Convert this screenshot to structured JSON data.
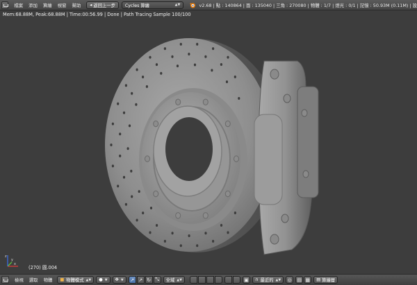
{
  "header": {
    "menus": [
      "檔案",
      "添加",
      "算繪",
      "視窗",
      "幫助"
    ],
    "back_button": "返回上一步",
    "render_engine": "Cycles 算繪",
    "stats": "v2.68 | 點 : 140864 | 面 : 135040 | 三角 : 270080 | 物體 : 1/7 | 燈光 : 0/1 | 記憶 : 50.93M (0.11M) | 設"
  },
  "viewport": {
    "render_status": "Mem:68.88M, Peak:68.88M | Time:00:56.99 | Done | Path Tracing Sample 100/100",
    "object_label": "(270) 圓.004"
  },
  "footer": {
    "menus": [
      "檢視",
      "選取",
      "物體"
    ],
    "mode": "物體模式",
    "pivot": "全域",
    "snap": "最近的",
    "render_layer": "算繪層"
  },
  "colors": {
    "viewport_bg": "#3d3d3d",
    "header_bg": "#4a4a4a",
    "axis_x": "#d13b3b",
    "axis_y": "#5ac03a",
    "axis_z": "#3b69d6",
    "active_blue": "#4a72aa"
  }
}
